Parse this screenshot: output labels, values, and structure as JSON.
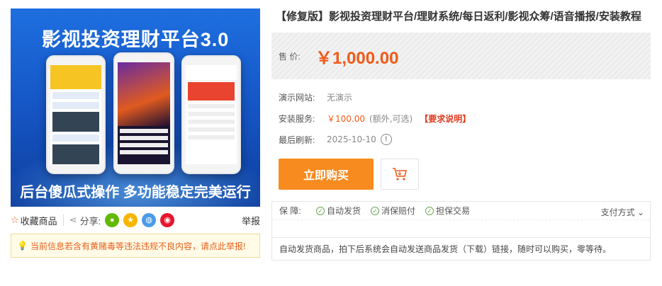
{
  "hero": {
    "title": "影视投资理财平台3.0",
    "bottom": "后台傻瓜式操作 多功能稳定完美运行"
  },
  "share_bar": {
    "fav_label": "收藏商品",
    "share_label": "分享:",
    "share_icons": [
      "wechat-icon",
      "qzone-icon",
      "qq-icon",
      "weibo-icon"
    ],
    "report_label": "举报"
  },
  "notice": "当前信息若含有黄赌毒等违法违规不良内容，请点此举报!",
  "product": {
    "title": "【修复版】影视投资理财平台/理财系统/每日返利/影视众筹/语音播报/安装教程",
    "price_label": "售 价:",
    "price": "￥1,000.00"
  },
  "info": {
    "demo_label": "演示网站:",
    "demo_value": "无演示",
    "install_label": "安装服务:",
    "install_price": "￥100.00",
    "install_note": "(额外,可选)",
    "install_req": "【要求说明】",
    "refresh_label": "最后刷新:",
    "refresh_value": "2025-10-10"
  },
  "buttons": {
    "buy": "立即购买"
  },
  "guarantee": {
    "label": "保 障:",
    "tags": [
      "自动发货",
      "消保赔付",
      "担保交易"
    ],
    "pay": "支付方式",
    "desc": "自动发货商品，拍下后系统会自动发送商品发货（下载）链接，随时可以购买，零等待。"
  },
  "colors": {
    "accent": "#f78b1f",
    "price": "#f05a18"
  }
}
